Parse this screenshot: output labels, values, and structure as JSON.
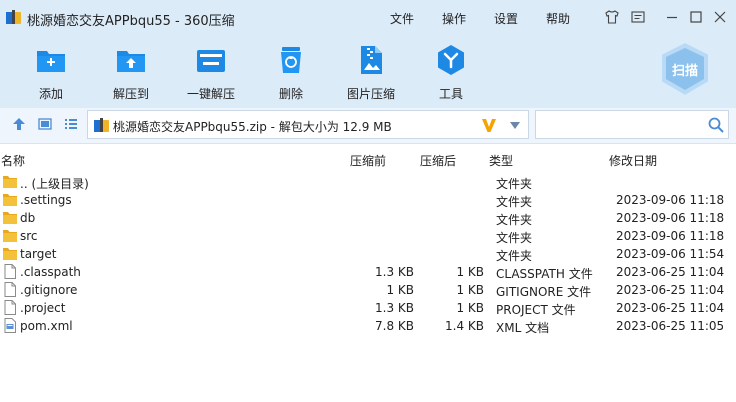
{
  "window": {
    "title": "桃源婚恋交友APPbqu55 - 360压缩",
    "menus": [
      "文件",
      "操作",
      "设置",
      "帮助"
    ]
  },
  "toolbar": {
    "items": [
      {
        "label": "添加",
        "icon": "add-icon"
      },
      {
        "label": "解压到",
        "icon": "extract-to-icon"
      },
      {
        "label": "一键解压",
        "icon": "one-click-extract-icon"
      },
      {
        "label": "删除",
        "icon": "delete-icon"
      },
      {
        "label": "图片压缩",
        "icon": "image-compress-icon"
      },
      {
        "label": "工具",
        "icon": "tools-icon"
      }
    ],
    "scan_label": "扫描"
  },
  "address": {
    "path_text": "桃源婚恋交友APPbqu55.zip - 解包大小为 12.9 MB",
    "search_placeholder": ""
  },
  "columns": {
    "name": "名称",
    "before": "压缩前",
    "after": "压缩后",
    "type": "类型",
    "date": "修改日期"
  },
  "files": [
    {
      "name": ".. (上级目录)",
      "before": "",
      "after": "",
      "type": "文件夹",
      "date": "",
      "kind": "folder"
    },
    {
      "name": ".settings",
      "before": "",
      "after": "",
      "type": "文件夹",
      "date": "2023-09-06 11:18",
      "kind": "folder"
    },
    {
      "name": "db",
      "before": "",
      "after": "",
      "type": "文件夹",
      "date": "2023-09-06 11:18",
      "kind": "folder"
    },
    {
      "name": "src",
      "before": "",
      "after": "",
      "type": "文件夹",
      "date": "2023-09-06 11:18",
      "kind": "folder"
    },
    {
      "name": "target",
      "before": "",
      "after": "",
      "type": "文件夹",
      "date": "2023-09-06 11:54",
      "kind": "folder"
    },
    {
      "name": ".classpath",
      "before": "1.3 KB",
      "after": "1 KB",
      "type": "CLASSPATH 文件",
      "date": "2023-06-25 11:04",
      "kind": "file"
    },
    {
      "name": ".gitignore",
      "before": "1 KB",
      "after": "1 KB",
      "type": "GITIGNORE 文件",
      "date": "2023-06-25 11:04",
      "kind": "file"
    },
    {
      "name": ".project",
      "before": "1.3 KB",
      "after": "1 KB",
      "type": "PROJECT 文件",
      "date": "2023-06-25 11:04",
      "kind": "file"
    },
    {
      "name": "pom.xml",
      "before": "7.8 KB",
      "after": "1.4 KB",
      "type": "XML 文档",
      "date": "2023-06-25 11:05",
      "kind": "xml"
    }
  ],
  "colors": {
    "toolbar_bg": "#dcebf8",
    "icon_blue": "#1e88e5",
    "folder_yellow": "#f3c13a"
  }
}
